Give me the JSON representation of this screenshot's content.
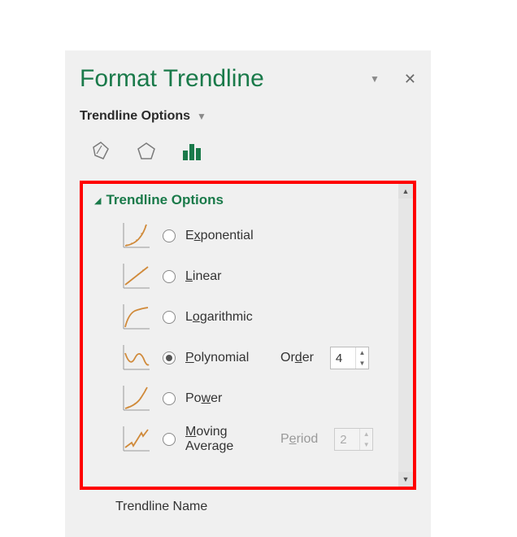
{
  "panel": {
    "title": "Format Trendline",
    "subheader": "Trendline Options"
  },
  "section": {
    "title": "Trendline Options"
  },
  "options": {
    "exponential": {
      "pre": "E",
      "hot": "x",
      "post": "ponential",
      "selected": false
    },
    "linear": {
      "pre": "",
      "hot": "L",
      "post": "inear",
      "selected": false
    },
    "logarithmic": {
      "pre": "L",
      "hot": "o",
      "post": "garithmic",
      "selected": false
    },
    "polynomial": {
      "pre": "",
      "hot": "P",
      "post": "olynomial",
      "selected": true,
      "param_pre": "Or",
      "param_hot": "d",
      "param_post": "er",
      "value": "4"
    },
    "power": {
      "pre": "Po",
      "hot": "w",
      "post": "er",
      "selected": false
    },
    "moving": {
      "line1_pre": "",
      "line1_hot": "M",
      "line1_post": "oving",
      "line2": "Average",
      "selected": false,
      "param_pre": "P",
      "param_hot": "e",
      "param_post": "riod",
      "value": "2"
    }
  },
  "below": {
    "trendline_name": "Trendline Name"
  }
}
